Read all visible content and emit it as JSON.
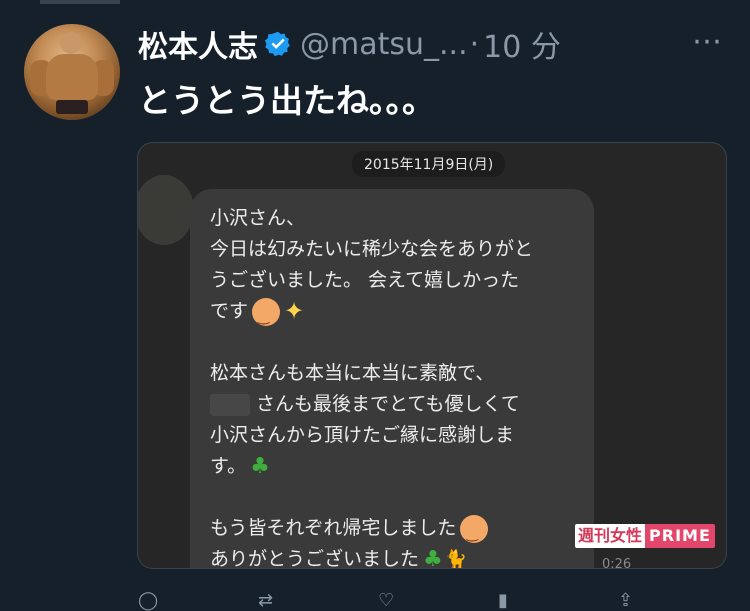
{
  "tweet": {
    "display_name": "松本人志",
    "handle": "@matsu_...",
    "separator": "·",
    "time": "10 分",
    "more_label": "⋯",
    "text": "とうとう出たね。。。"
  },
  "media": {
    "date": "2015年11月9日(月)",
    "lines": [
      "小沢さん、",
      "今日は幻みたいに稀少な会をありがと",
      "うございました。 会えて嬉しかった",
      "です",
      "",
      "松本さんも本当に本当に素敵で、",
      "さんも最後までとても優しくて",
      "小沢さんから頂けたご縁に感謝しま",
      "す。",
      "",
      "もう皆それぞれ帰宅しました",
      "ありがとうございました"
    ],
    "duration": "0:26",
    "watermark_a": "週刊女性",
    "watermark_b": "PRIME"
  },
  "icons": {
    "verified": "verified-badge-icon",
    "more": "more-icon"
  },
  "colors": {
    "background": "#15202b",
    "secondary_text": "#8b98a5",
    "verified_blue": "#1d9bf0"
  }
}
